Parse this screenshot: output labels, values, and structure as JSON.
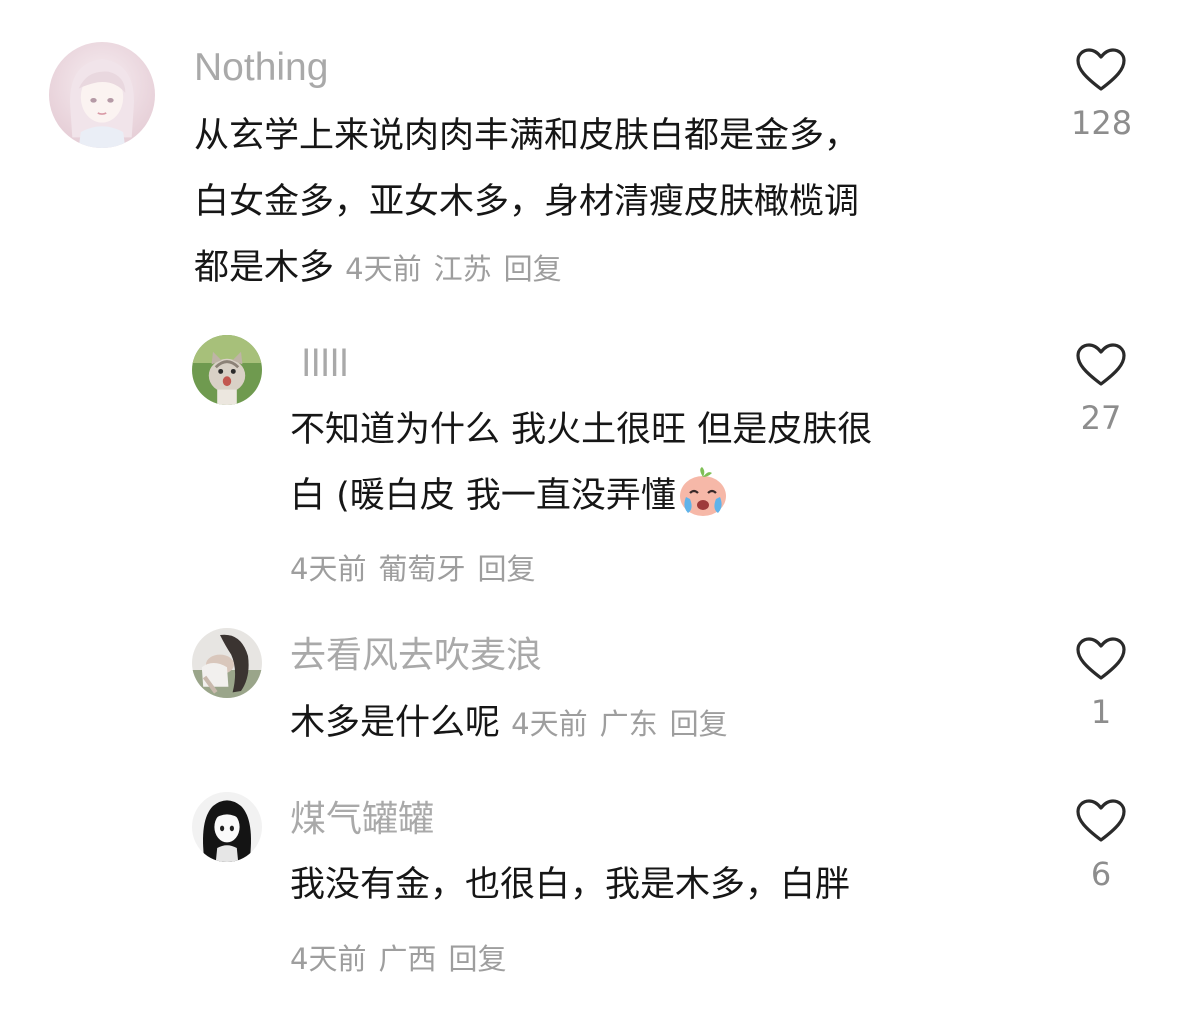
{
  "comments": [
    {
      "name": "Nothing",
      "text_lines": [
        "从玄学上来说肉肉丰满和皮肤白都是金多，",
        "白女金多，亚女木多，身材清瘦皮肤橄榄调",
        "都是木多"
      ],
      "time": "4天前",
      "location": "江苏",
      "reply_label": "回复",
      "likes": "128",
      "avatar_icon": "anime-girl-avatar-icon"
    },
    {
      "name": "lllll",
      "text_lines": [
        "不知道为什么 我火土很旺 但是皮肤很",
        "白 (暖白皮 我一直没弄懂"
      ],
      "emoji_icon": "crying-face-emoji-icon",
      "time": "4天前",
      "location": "葡萄牙",
      "reply_label": "回复",
      "likes": "27",
      "avatar_icon": "kitten-avatar-icon"
    },
    {
      "name": "去看风去吹麦浪",
      "text_lines": [
        "木多是什么呢"
      ],
      "time": "4天前",
      "location": "广东",
      "reply_label": "回复",
      "likes": "1",
      "avatar_icon": "girl-photo-avatar-icon"
    },
    {
      "name": "煤气罐罐",
      "text_lines": [
        "我没有金，也很白，我是木多，白胖"
      ],
      "time": "4天前",
      "location": "广西",
      "reply_label": "回复",
      "likes": "6",
      "avatar_icon": "monochrome-girl-avatar-icon"
    }
  ],
  "colors": {
    "name_gray": "#a9a9a9",
    "text_dark": "#161616",
    "meta_gray": "#9e9e9e",
    "heart_stroke": "#2a2a2a"
  }
}
